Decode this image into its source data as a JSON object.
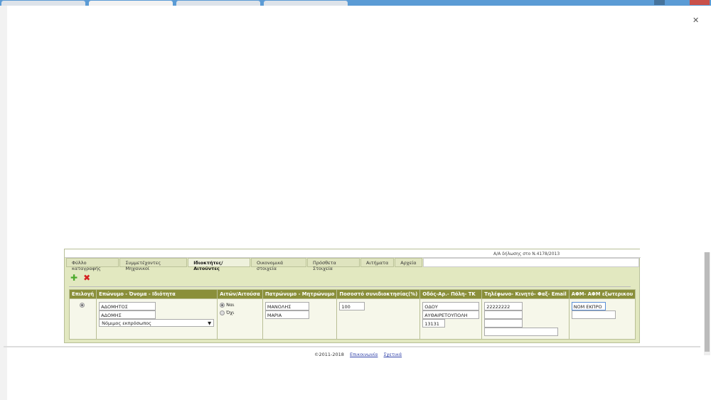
{
  "browser": {
    "tab_count": 4
  },
  "panel": {
    "declaration": "Α/Α δήλωσης στο Ν.4178/2013",
    "tabs": [
      {
        "label": "Φύλλο καταγραφής"
      },
      {
        "label": "Συμμετέχοντες Μηχανικοί"
      },
      {
        "label": "Ιδιοκτήτες/Αιτούντες",
        "active": true
      },
      {
        "label": "Οικονομικά στοιχεία"
      },
      {
        "label": "Πρόσθετα Στοιχεία"
      },
      {
        "label": "Αιτήματα"
      },
      {
        "label": "Αρχεία"
      }
    ],
    "toolbar": {
      "add_icon": "plus-icon",
      "delete_icon": "x-icon"
    },
    "table": {
      "headers": [
        "Επιλογή",
        "Επώνυμο - Όνομα - Ιδιότητα",
        "Αιτών/Αιτούσα",
        "Πατρώνυμο - Μητρώνυμο",
        "Ποσοστό συνιδιοκτησίας(%)",
        "Οδός-Αρ.- Πόλη- ΤΚ",
        "Τηλέφωνο- Κινητό- Φαξ- Email",
        "ΑΦΜ- ΑΦΜ εξωτερικου"
      ],
      "row": {
        "surname": "ΑΔΟΜΗΤΟΣ",
        "name": "ΑΔΟΜΗΣ",
        "capacity": "Νόμιμος εκπρόσωπος",
        "applicant_yes": "Ναι",
        "applicant_no": "Όχι",
        "applicant_selected": "Ναι",
        "father": "ΜΑΝΟΛΗΣ",
        "mother": "ΜΑΡΙΑ",
        "percent": "100",
        "street": "ΟΔΟΥ",
        "city": "ΑΥΘΑΙΡΕΤΟΥΠΟΛΗ",
        "zip": "13131",
        "phone": "22222222",
        "mobile": "",
        "fax": "",
        "email": "",
        "afm": "ΝΟΜ ΕΚΠΡΟ",
        "afm_foreign": ""
      }
    }
  },
  "footer": {
    "copyright": "©2011-2018",
    "contact": "Επικοινωνία",
    "about": "Σχετικά"
  }
}
